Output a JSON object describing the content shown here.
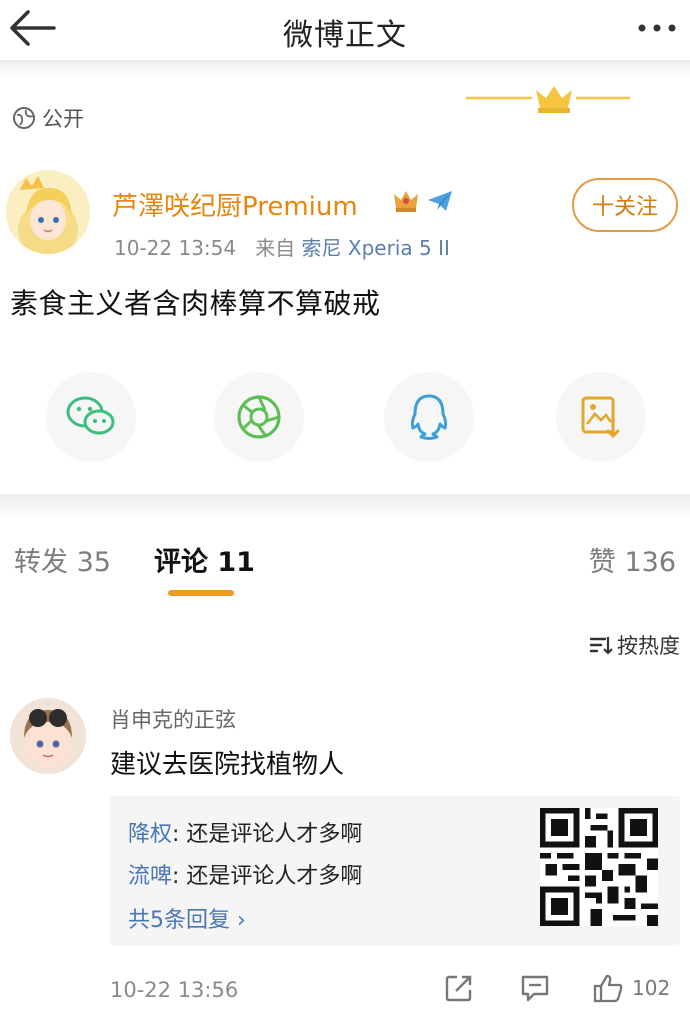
{
  "header": {
    "title": "微博正文"
  },
  "post": {
    "visibility": "公开",
    "author": "芦澤咲纪厨Premium",
    "time": "10-22 13:54",
    "source_prefix": "来自",
    "source": "索尼 Xperia 5 II",
    "follow_label": "十关注",
    "text": "素食主义者含肉棒算不算破戒"
  },
  "share": [
    {
      "icon": "wechat-icon",
      "color": "#3cbf7d"
    },
    {
      "icon": "moments-icon",
      "color": "#5cbf55"
    },
    {
      "icon": "qq-icon",
      "color": "#3d9fd6"
    },
    {
      "icon": "save-image-icon",
      "color": "#e3a72b"
    }
  ],
  "tabs": {
    "repost": "转发 35",
    "comments": "评论 11",
    "likes": "赞 136"
  },
  "sort": {
    "label": "按热度"
  },
  "comment": {
    "user": "肖申克的正弦",
    "text": "建议去医院找植物人",
    "replies": [
      {
        "user": "降权",
        "text": ": 还是评论人才多啊"
      },
      {
        "user": "流啤",
        "text": ": 还是评论人才多啊"
      }
    ],
    "more_replies": "共5条回复 ›",
    "time": "10-22 13:56",
    "like_count": "102"
  },
  "colors": {
    "accent": "#f09a1e",
    "name": "#e8860c",
    "link": "#4a76b8"
  }
}
